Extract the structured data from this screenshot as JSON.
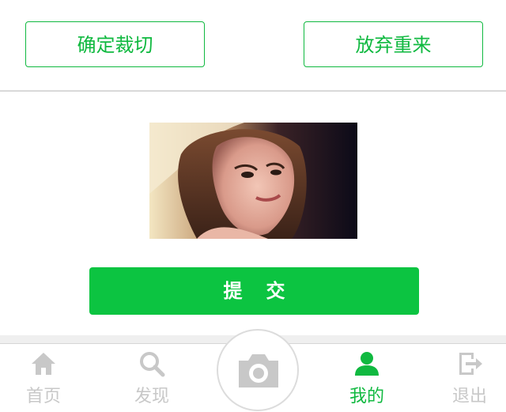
{
  "crop_actions": {
    "confirm_label": "确定裁切",
    "discard_label": "放弃重来"
  },
  "preview": {
    "alt": "cropped portrait photo"
  },
  "submit_label": "提交",
  "tabbar": {
    "items": [
      {
        "label": "首页",
        "icon": "home-icon",
        "active": false
      },
      {
        "label": "发现",
        "icon": "search-icon",
        "active": false
      },
      {
        "label": "",
        "icon": "camera-icon",
        "active": false
      },
      {
        "label": "我的",
        "icon": "user-icon",
        "active": true
      },
      {
        "label": "退出",
        "icon": "logout-icon",
        "active": false
      }
    ]
  },
  "colors": {
    "accent": "#10b940",
    "submit_bg": "#0cc441",
    "inactive": "#c8c8c8"
  }
}
